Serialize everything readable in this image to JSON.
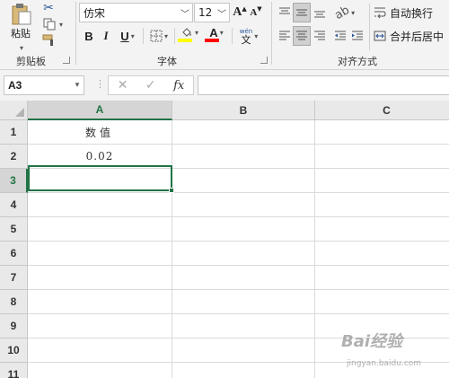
{
  "ribbon": {
    "clipboard": {
      "paste_label": "粘贴",
      "group_label": "剪贴板"
    },
    "font": {
      "font_name": "仿宋",
      "font_size": "12",
      "bold": "B",
      "italic": "I",
      "underline": "U",
      "grow_font": "A",
      "shrink_font": "A",
      "font_color_letter": "A",
      "phonetic_top": "wén",
      "phonetic_bottom": "文",
      "group_label": "字体",
      "fill_color": "#FFFF00",
      "font_color": "#FF0000"
    },
    "alignment": {
      "wrap_text_label": "自动换行",
      "merge_center_label": "合并后居中",
      "group_label": "对齐方式"
    }
  },
  "formula_bar": {
    "name_box": "A3",
    "cancel": "✕",
    "enter": "✓",
    "fx": "fx",
    "formula": ""
  },
  "sheet": {
    "columns": [
      "A",
      "B",
      "C"
    ],
    "rows": [
      "1",
      "2",
      "3",
      "4",
      "5",
      "6",
      "7",
      "8",
      "9",
      "10",
      "11"
    ],
    "cells": {
      "A1": "数值",
      "A2": "0.02"
    },
    "selected_cell": "A3",
    "accent_color": "#217346"
  },
  "watermark": {
    "brand": "Bai经验",
    "url": "jingyan.baidu.com"
  }
}
